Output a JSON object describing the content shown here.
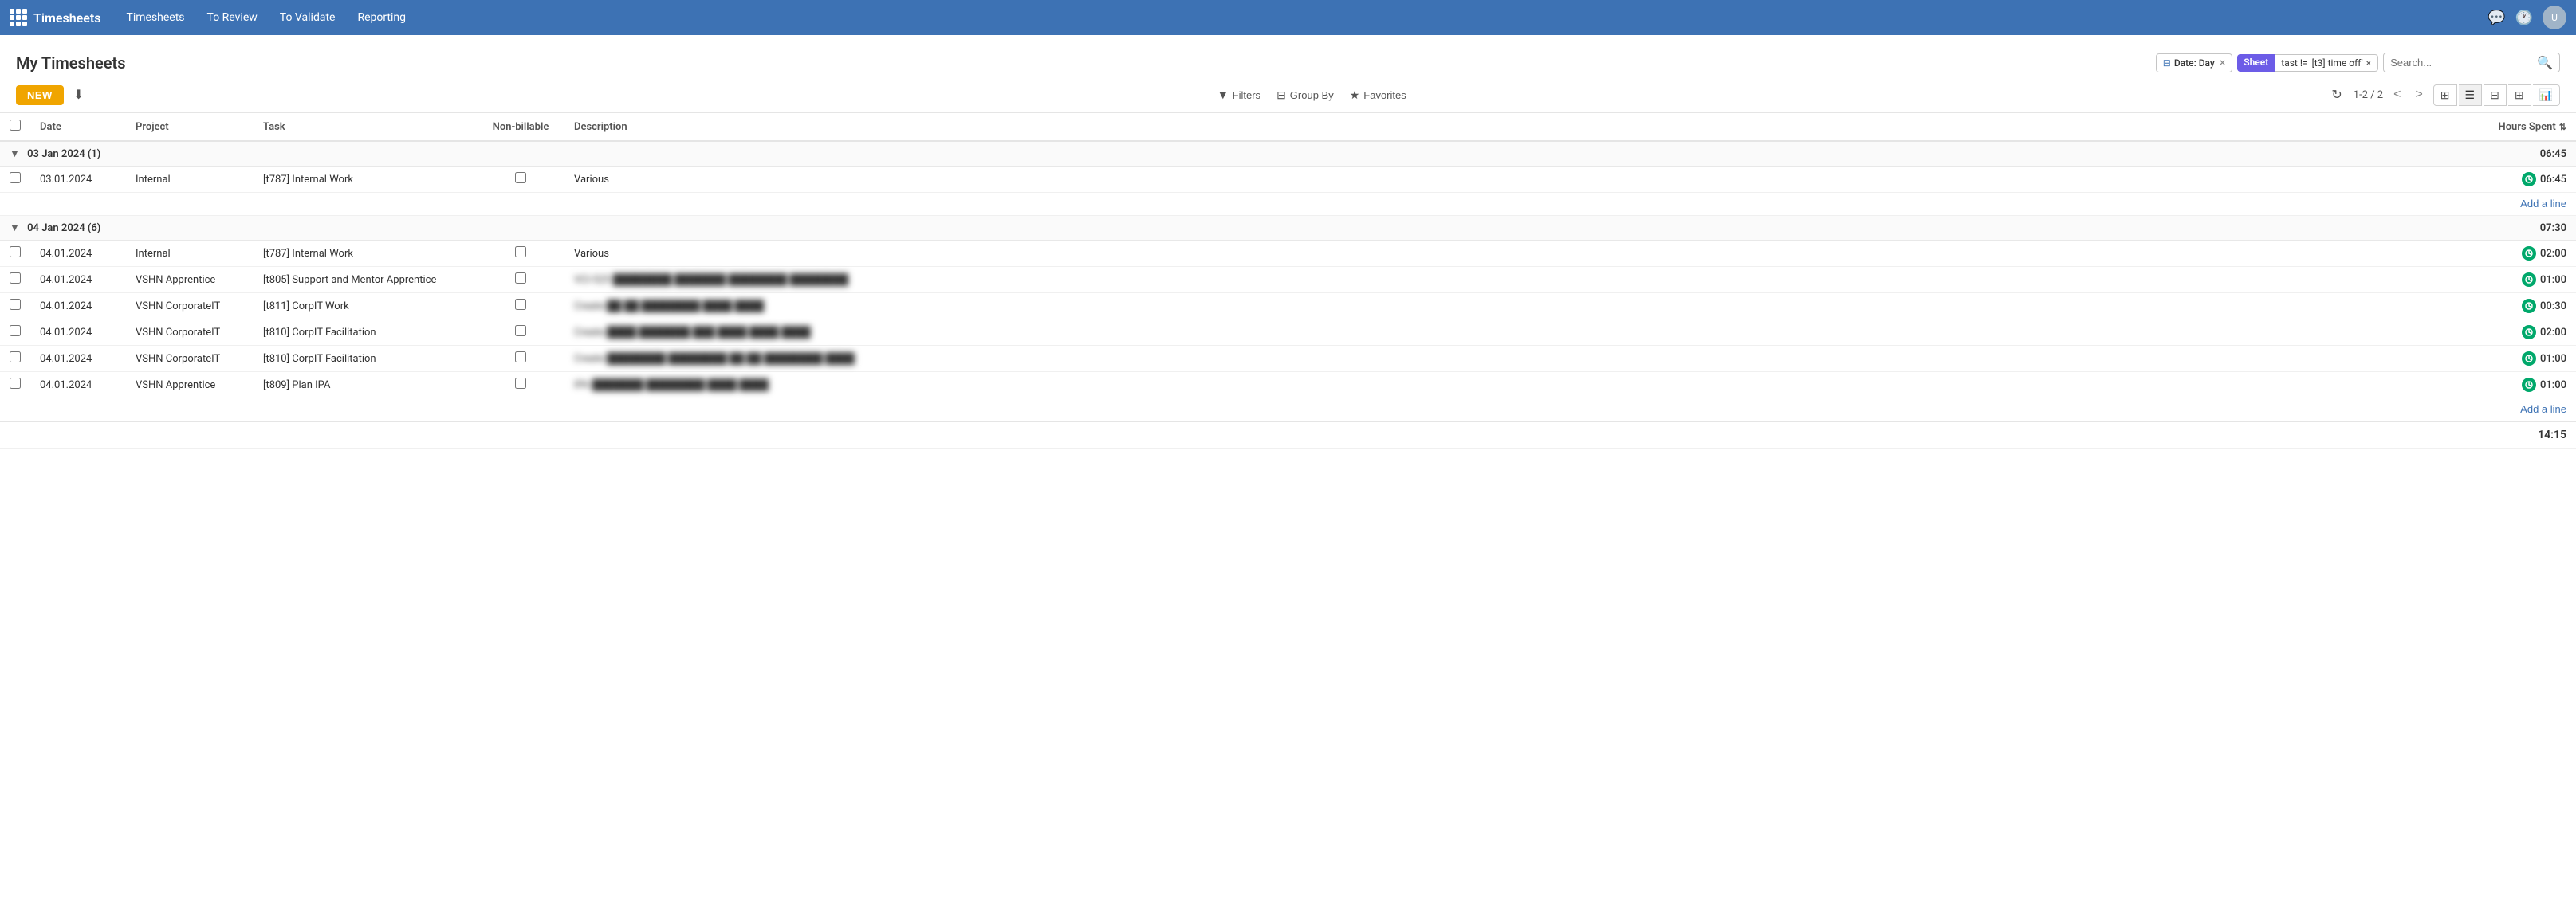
{
  "app": {
    "name": "Timesheets"
  },
  "topnav": {
    "links": [
      "Timesheets",
      "To Review",
      "To Validate",
      "Reporting"
    ],
    "icons": [
      "chat-icon",
      "clock-icon"
    ]
  },
  "page": {
    "title": "My Timesheets"
  },
  "toolbar": {
    "new_label": "NEW",
    "download_icon": "download-icon"
  },
  "filters": {
    "date_label": "Date: Day",
    "date_x": "×",
    "sheet_label": "Sheet",
    "sheet_value_label": "tast != '[t3] time off'",
    "sheet_x": "×",
    "search_placeholder": "Search..."
  },
  "controls": {
    "filters_label": "Filters",
    "groupby_label": "Group By",
    "favorites_label": "Favorites",
    "refresh_icon": "refresh-icon",
    "pager": "1-2 / 2",
    "prev_icon": "chevron-left-icon",
    "next_icon": "chevron-right-icon",
    "views": [
      "grid-icon",
      "list-icon",
      "kanban-icon",
      "pivot-icon",
      "chart-icon"
    ]
  },
  "table": {
    "headers": [
      "",
      "Date",
      "Project",
      "Task",
      "Non-billable",
      "Description",
      "Hours Spent"
    ],
    "groups": [
      {
        "label": "03 Jan 2024 (1)",
        "total": "06:45",
        "rows": [
          {
            "date": "03.01.2024",
            "project": "Internal",
            "task": "[t787] Internal Work",
            "nonbillable": false,
            "description": "Various",
            "description_blurred": false,
            "hours": "06:45"
          }
        ]
      },
      {
        "label": "04 Jan 2024 (6)",
        "total": "07:30",
        "rows": [
          {
            "date": "04.01.2024",
            "project": "Internal",
            "task": "[t787] Internal Work",
            "nonbillable": false,
            "description": "Various",
            "description_blurred": false,
            "hours": "02:00"
          },
          {
            "date": "04.01.2024",
            "project": "VSHN Apprentice",
            "task": "[t805] Support and Mentor Apprentice",
            "nonbillable": false,
            "description": "VCI-525 ████████ ███████ ████████ ████████",
            "description_blurred": true,
            "hours": "01:00"
          },
          {
            "date": "04.01.2024",
            "project": "VSHN CorporateIT",
            "task": "[t811] CorpIT Work",
            "nonbillable": false,
            "description": "Create ██ ██ ████████ ████ ████",
            "description_blurred": true,
            "hours": "00:30"
          },
          {
            "date": "04.01.2024",
            "project": "VSHN CorporateIT",
            "task": "[t810] CorpIT Facilitation",
            "nonbillable": false,
            "description": "Create ████ ███████ ███ ████ ████ ████",
            "description_blurred": true,
            "hours": "02:00"
          },
          {
            "date": "04.01.2024",
            "project": "VSHN CorporateIT",
            "task": "[t810] CorpIT Facilitation",
            "nonbillable": false,
            "description": "Create ████████ ████████ ██ ██ ████████ ████",
            "description_blurred": true,
            "hours": "01:00"
          },
          {
            "date": "04.01.2024",
            "project": "VSHN Apprentice",
            "task": "[t809] Plan IPA",
            "nonbillable": false,
            "description": "IPA ███████ ████████ ████ ████",
            "description_blurred": true,
            "hours": "01:00"
          }
        ]
      }
    ],
    "add_line_label": "Add a line",
    "footer_total": "14:15"
  }
}
